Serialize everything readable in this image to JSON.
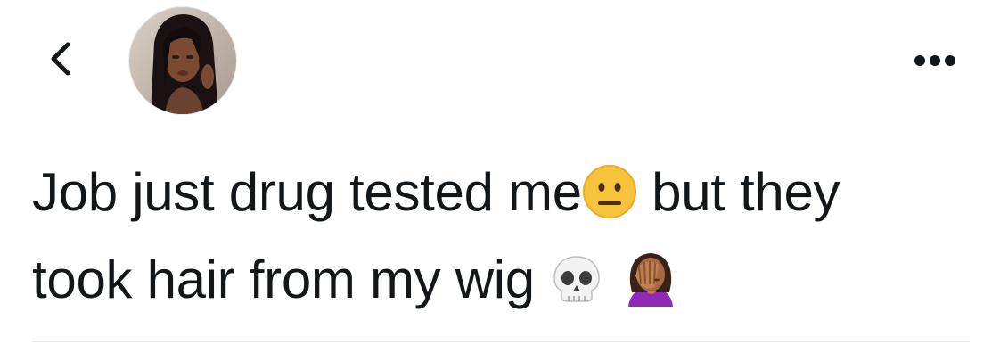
{
  "header": {
    "back_icon": "chevron-left-icon",
    "avatar_icon": "profile-photo",
    "more_icon": "ellipsis-icon"
  },
  "tweet": {
    "line1_text": "Job just drug tested me",
    "line1_emoji": "neutral-face-emoji",
    "line1_tail": " but they",
    "line2_text": "took hair from my wig ",
    "line2_emoji1": "skull-emoji",
    "line2_emoji2": "woman-facepalming-emoji"
  },
  "colors": {
    "text": "#14171a",
    "divider": "#e1e8ed",
    "emoji_yellow": "#f7c33c",
    "emoji_purple": "#8e2ab5"
  }
}
